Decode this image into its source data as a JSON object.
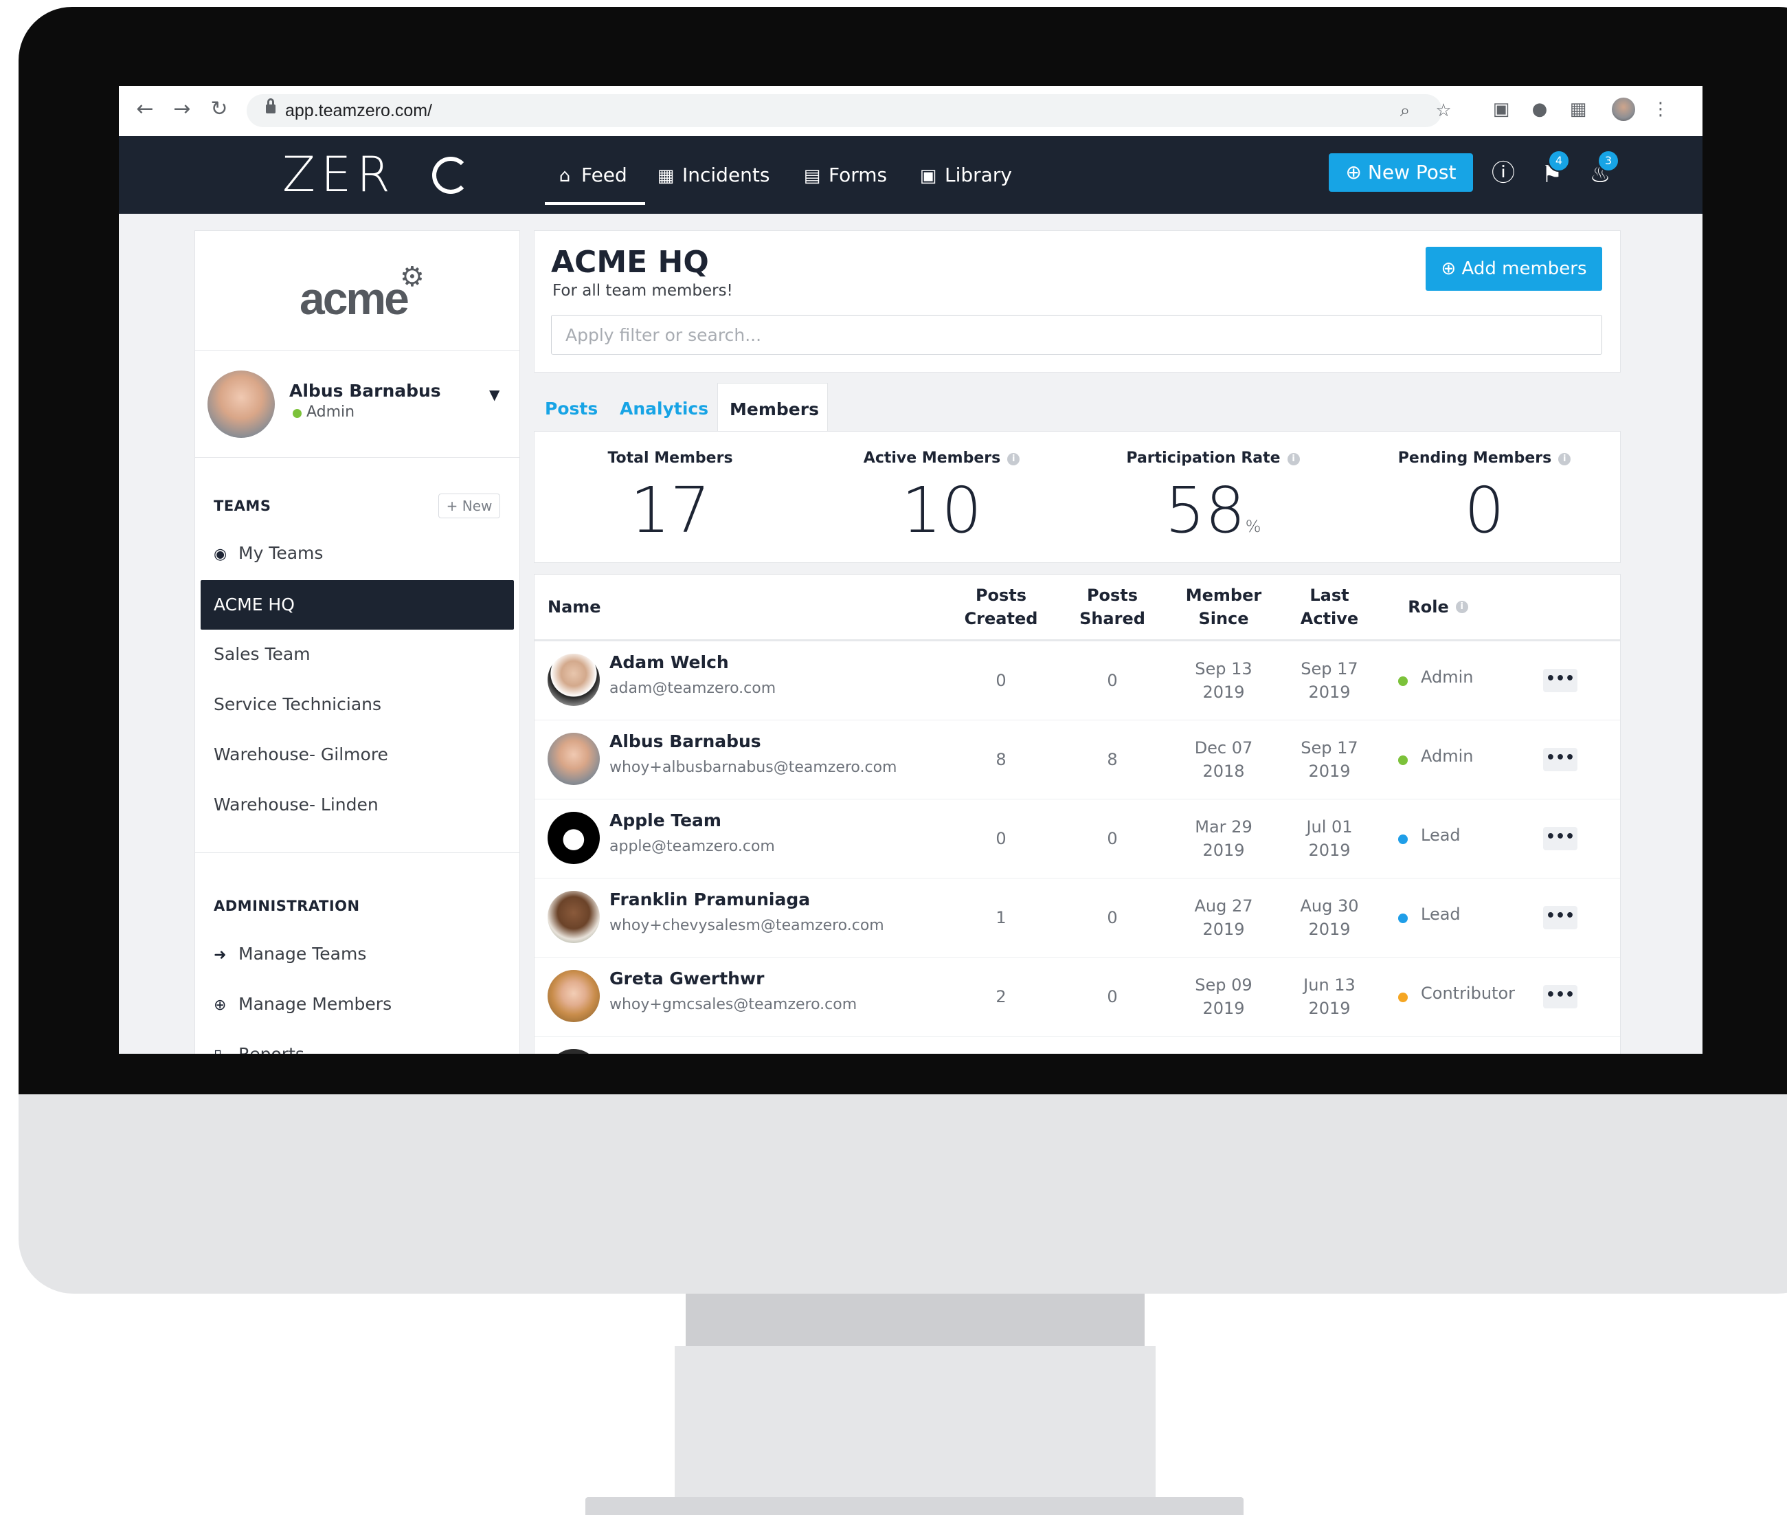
{
  "browser": {
    "url": "app.teamzero.com/"
  },
  "header": {
    "logo": "ZERO",
    "nav": [
      {
        "label": "Feed",
        "icon": "home-icon"
      },
      {
        "label": "Incidents",
        "icon": "clipboard-icon"
      },
      {
        "label": "Forms",
        "icon": "form-icon"
      },
      {
        "label": "Library",
        "icon": "book-icon"
      }
    ],
    "new_post_label": "New Post",
    "pin_badge": "4",
    "bell_badge": "3"
  },
  "sidebar": {
    "org_logo": "acme",
    "user": {
      "name": "Albus Barnabus",
      "role": "Admin"
    },
    "teams_heading": "TEAMS",
    "new_team_label": "+ New",
    "my_teams_label": "My Teams",
    "teams": [
      "ACME HQ",
      "Sales Team",
      "Service Technicians",
      "Warehouse- Gilmore",
      "Warehouse- Linden"
    ],
    "admin_heading": "ADMINISTRATION",
    "admin_items": [
      "Manage Teams",
      "Manage Members",
      "Reports"
    ]
  },
  "main": {
    "title": "ACME HQ",
    "subtitle": "For all team members!",
    "add_members_label": "Add members",
    "search_placeholder": "Apply filter or search...",
    "tabs": [
      "Posts",
      "Analytics",
      "Members"
    ],
    "active_tab": "Members"
  },
  "stats": [
    {
      "label": "Total Members",
      "value": "17",
      "unit": ""
    },
    {
      "label": "Active Members",
      "value": "10",
      "unit": ""
    },
    {
      "label": "Participation Rate",
      "value": "58",
      "unit": "%"
    },
    {
      "label": "Pending Members",
      "value": "0",
      "unit": ""
    }
  ],
  "table": {
    "columns": [
      "Name",
      "Posts Created",
      "Posts Shared",
      "Member Since",
      "Last Active",
      "Role"
    ],
    "rows": [
      {
        "name": "Adam Welch",
        "email": "adam@teamzero.com",
        "posts_created": "0",
        "posts_shared": "0",
        "member_since": "Sep 13 2019",
        "last_active": "Sep 17 2019",
        "role": "Admin",
        "role_color": "#7cc23a"
      },
      {
        "name": "Albus Barnabus",
        "email": "whoy+albusbarnabus@teamzero.com",
        "posts_created": "8",
        "posts_shared": "8",
        "member_since": "Dec 07 2018",
        "last_active": "Sep 17 2019",
        "role": "Admin",
        "role_color": "#7cc23a"
      },
      {
        "name": "Apple Team",
        "email": "apple@teamzero.com",
        "posts_created": "0",
        "posts_shared": "0",
        "member_since": "Mar 29 2019",
        "last_active": "Jul 01 2019",
        "role": "Lead",
        "role_color": "#1f9ee8"
      },
      {
        "name": "Franklin Pramuniaga",
        "email": "whoy+chevysalesm@teamzero.com",
        "posts_created": "1",
        "posts_shared": "0",
        "member_since": "Aug 27 2019",
        "last_active": "Aug 30 2019",
        "role": "Lead",
        "role_color": "#1f9ee8"
      },
      {
        "name": "Greta Gwerthwr",
        "email": "whoy+gmcsales@teamzero.com",
        "posts_created": "2",
        "posts_shared": "0",
        "member_since": "Sep 09 2019",
        "last_active": "Jun 13 2019",
        "role": "Contributor",
        "role_color": "#f5a623"
      }
    ]
  },
  "colors": {
    "accent": "#17a4e5",
    "header_bg": "#1c2431",
    "admin_dot": "#7cc23a",
    "lead_dot": "#1f9ee8",
    "contributor_dot": "#f5a623"
  }
}
